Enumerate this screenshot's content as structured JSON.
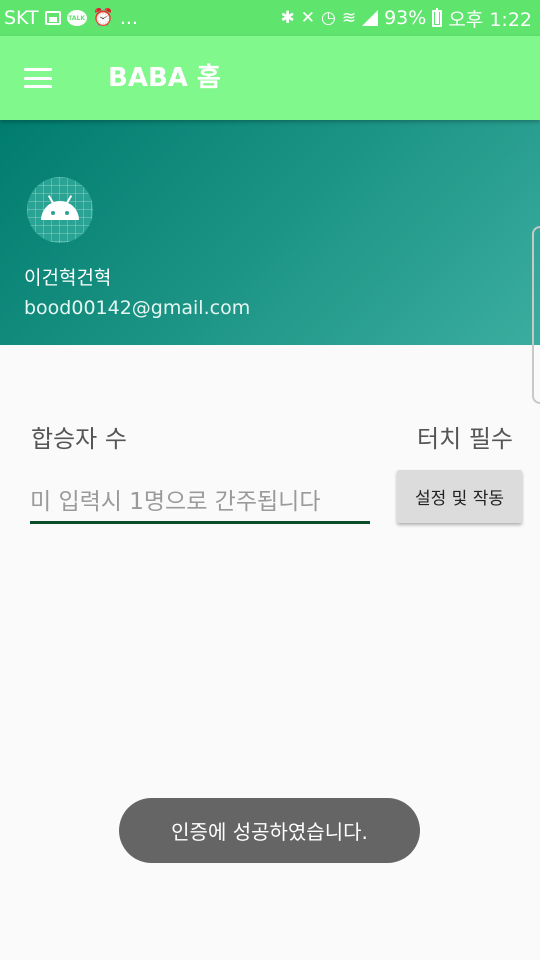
{
  "status_bar": {
    "carrier": "SKT",
    "more": "...",
    "kakao_text": "TALK",
    "battery": "93%",
    "time": "오후 1:22"
  },
  "app_bar": {
    "title": "BABA 홈"
  },
  "nav_header": {
    "user_name": "이건혁건혁",
    "user_email": "bood00142@gmail.com"
  },
  "form": {
    "passenger_label": "합승자 수",
    "touch_label": "터치 필수",
    "passenger_placeholder": "미 입력시 1명으로 간주됩니다",
    "setup_button": "설정 및 작동"
  },
  "toast": {
    "message": "인증에 성공하였습니다."
  },
  "colors": {
    "status_bar": "#5fe46d",
    "app_bar": "#80f88c",
    "header_start": "#007c6e",
    "header_end": "#3bada0",
    "toast": "#656565"
  }
}
